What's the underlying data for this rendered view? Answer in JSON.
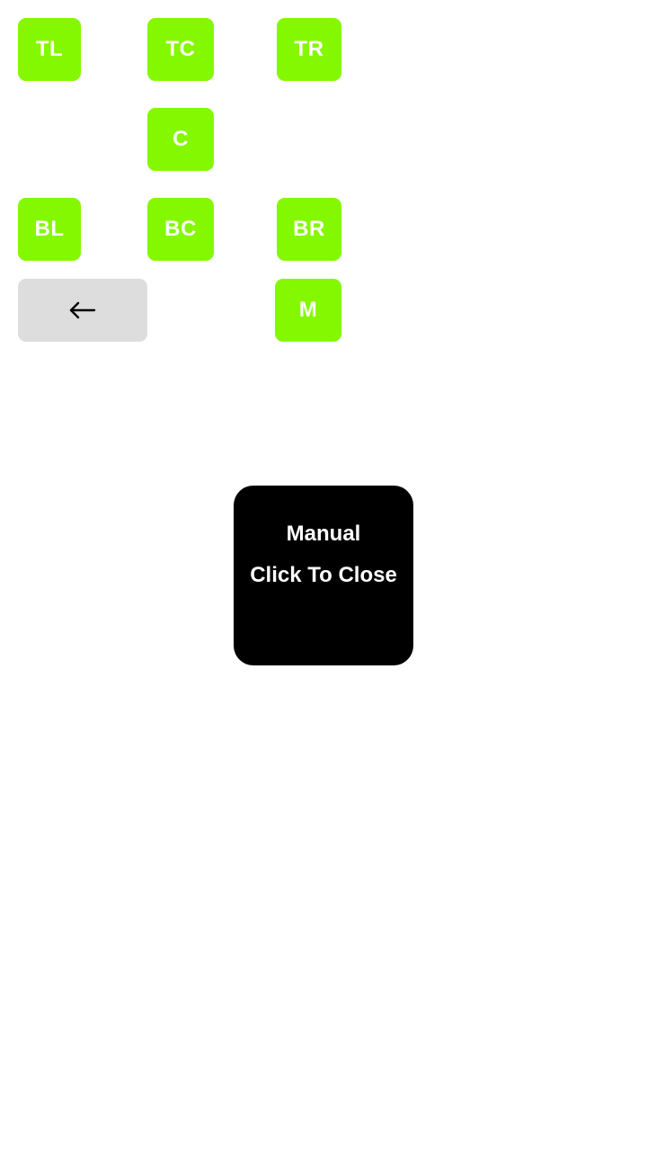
{
  "buttons": {
    "tl": "TL",
    "tc": "TC",
    "tr": "TR",
    "c": "C",
    "bl": "BL",
    "bc": "BC",
    "br": "BR",
    "m": "M"
  },
  "back_button": {
    "icon": "arrow-left-icon"
  },
  "popup": {
    "title": "Manual",
    "subtitle": "Click To Close"
  },
  "colors": {
    "button_bg": "#84f800",
    "button_text": "#ffffff",
    "back_bg": "#dddddd",
    "popup_bg": "#000000",
    "popup_text": "#ffffff"
  }
}
